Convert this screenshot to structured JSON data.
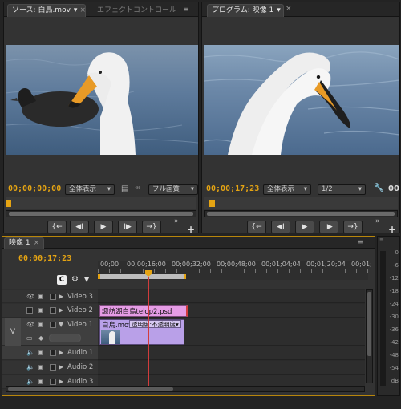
{
  "source_monitor": {
    "tab_source": "ソース: 白鳥.mov",
    "tab_effects": "エフェクトコントロール",
    "timecode": "00;00;00;00",
    "view_select": "全体表示",
    "quality_select": "フル画質"
  },
  "program_monitor": {
    "tab_program": "プログラム: 映像 1",
    "timecode": "00;00;17;23",
    "view_select": "全体表示",
    "quality_select": "1/2",
    "duration_partial": "00"
  },
  "timeline": {
    "tab_label": "映像 1",
    "timecode": "00;00;17;23",
    "ruler_labels": [
      "00;00",
      "00;00;16;00",
      "00;00;32;00",
      "00;00;48;00",
      "00;01;04;04",
      "00;01;20;04",
      "00;01;"
    ],
    "tracks": [
      {
        "name": "Video 3"
      },
      {
        "name": "Video 2"
      },
      {
        "name": "Video 1"
      },
      {
        "name": "Audio 1"
      },
      {
        "name": "Audio 2"
      },
      {
        "name": "Audio 3"
      }
    ],
    "v_target_label": "V",
    "clip_telop": "諏訪湖白鳥telop2.psd",
    "clip_video_name": "白鳥.mov",
    "clip_video_fx": "透明度:不透明度"
  },
  "audio_meter": {
    "labels": [
      "0",
      "-6",
      "-12",
      "-18",
      "-24",
      "-30",
      "-36",
      "-42",
      "-48",
      "-54",
      "dB"
    ]
  },
  "colors": {
    "timecode": "#e5a413",
    "playhead": "#d23c3c",
    "clip_telop": "#e59ce5",
    "clip_video": "#b9a0e8"
  }
}
